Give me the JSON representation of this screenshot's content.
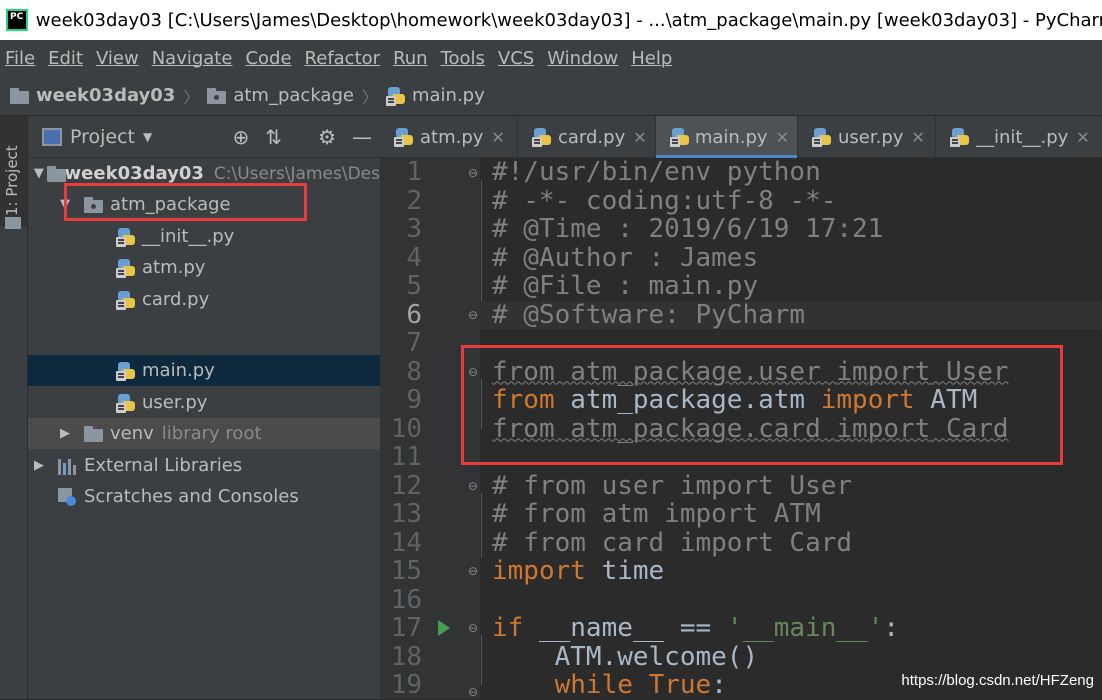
{
  "window": {
    "title": "week03day03 [C:\\Users\\James\\Desktop\\homework\\week03day03] - ...\\atm_package\\main.py [week03day03] - PyCharm",
    "app_icon": "PC"
  },
  "menu": [
    "File",
    "Edit",
    "View",
    "Navigate",
    "Code",
    "Refactor",
    "Run",
    "Tools",
    "VCS",
    "Window",
    "Help"
  ],
  "breadcrumb": [
    "week03day03",
    "atm_package",
    "main.py"
  ],
  "side_strip": {
    "label": "1: Project"
  },
  "project_panel": {
    "title": "Project",
    "tree": {
      "root": {
        "name": "week03day03",
        "path": "C:\\Users\\James\\Des"
      },
      "package": "atm_package",
      "files": [
        "__init__.py",
        "atm.py",
        "card.py",
        "main.py",
        "user.py"
      ],
      "venv": {
        "name": "venv",
        "hint": "library root"
      },
      "external": "External Libraries",
      "scratches": "Scratches and Consoles"
    }
  },
  "tabs": [
    "atm.py",
    "card.py",
    "main.py",
    "user.py",
    "__init__.py"
  ],
  "active_tab": "main.py",
  "code": {
    "line_numbers": [
      "1",
      "2",
      "3",
      "4",
      "5",
      "6",
      "7",
      "8",
      "9",
      "10",
      "11",
      "12",
      "13",
      "14",
      "15",
      "16",
      "17",
      "18",
      "19"
    ],
    "current_line": "6",
    "l1": "#!/usr/bin/env python",
    "l2": "# -*- coding:utf-8 -*-",
    "l3": "# @Time : 2019/6/19 17:21",
    "l4": "# @Author : James",
    "l5": "# @File : main.py",
    "l6": "# @Software: PyCharm",
    "l8": {
      "kw1": "from",
      "mod": " atm_package.user ",
      "kw2": "import",
      "name": " User"
    },
    "l9": {
      "kw1": "from",
      "mod": " atm_package.atm ",
      "kw2": "import",
      "name": " ATM"
    },
    "l10": {
      "kw1": "from",
      "mod": " atm_package.card ",
      "kw2": "import",
      "name": " Card"
    },
    "l12": "# from user import User",
    "l13": "# from atm import ATM",
    "l14": "# from card import Card",
    "l15": {
      "kw": "import",
      "rest": " time"
    },
    "l17": {
      "kw": "if",
      "mid": " __name__ == ",
      "str": "'__main__'",
      "end": ":"
    },
    "l18": "    ATM.welcome()",
    "l19": {
      "indent": "    ",
      "kw1": "while",
      "sp": " ",
      "kw2": "True",
      "end": ":"
    }
  },
  "watermark": "https://blog.csdn.net/HFZeng",
  "colors": {
    "highlight_box": "#e83b3b",
    "keyword": "#cc7832",
    "comment": "#808080",
    "string": "#6a8759"
  }
}
